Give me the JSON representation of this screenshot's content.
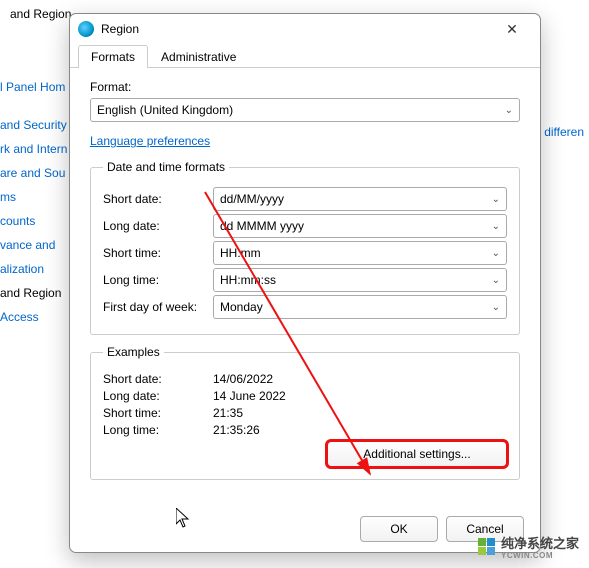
{
  "bg": {
    "header": "and Region",
    "sidebar_home": "l Panel Hom",
    "items": [
      "and Security",
      "rk and Intern",
      "are and Sou",
      "ms",
      "counts",
      "vance and",
      "alization"
    ],
    "region_item": "and Region",
    "access_item": "Access",
    "right_link": "differen"
  },
  "dialog": {
    "title": "Region",
    "tabs": {
      "formats": "Formats",
      "admin": "Administrative"
    },
    "format_label": "Format:",
    "format_value": "English (United Kingdom)",
    "lang_prefs": "Language preferences",
    "group_dtf": "Date and time formats",
    "fields": {
      "short_date": {
        "label": "Short date:",
        "value": "dd/MM/yyyy"
      },
      "long_date": {
        "label": "Long date:",
        "value": "dd MMMM yyyy"
      },
      "short_time": {
        "label": "Short time:",
        "value": "HH:mm"
      },
      "long_time": {
        "label": "Long time:",
        "value": "HH:mm:ss"
      },
      "first_day": {
        "label": "First day of week:",
        "value": "Monday"
      }
    },
    "group_ex": "Examples",
    "examples": {
      "short_date": {
        "label": "Short date:",
        "value": "14/06/2022"
      },
      "long_date": {
        "label": "Long date:",
        "value": "14 June 2022"
      },
      "short_time": {
        "label": "Short time:",
        "value": "21:35"
      },
      "long_time": {
        "label": "Long time:",
        "value": "21:35:26"
      }
    },
    "additional": "Additional settings...",
    "ok": "OK",
    "cancel": "Cancel"
  },
  "watermark": {
    "name": "纯净系统之家",
    "sub": "YCWIN.COM"
  }
}
